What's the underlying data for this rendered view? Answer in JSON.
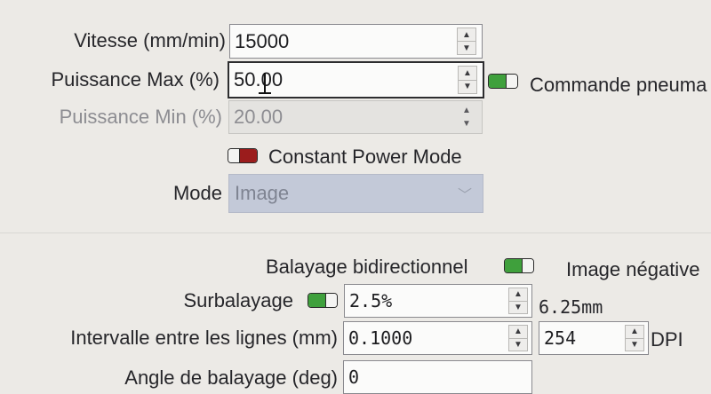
{
  "speed": {
    "label": "Vitesse (mm/min)",
    "value": "15000"
  },
  "power_max": {
    "label": "Puissance Max (%)",
    "value": "50.00"
  },
  "air_assist": {
    "label": "Commande pneuma"
  },
  "power_min": {
    "label": "Puissance Min (%)",
    "value": "20.00"
  },
  "constant_power": {
    "label": "Constant Power Mode"
  },
  "mode": {
    "label": "Mode",
    "value": "Image"
  },
  "bidirectional": {
    "label": "Balayage bidirectionnel"
  },
  "negative": {
    "label": "Image négative"
  },
  "overscan": {
    "label": "Surbalayage",
    "value": "2.5%",
    "computed": "6.25mm"
  },
  "line_interval": {
    "label": "Intervalle entre les lignes (mm)",
    "value": "0.1000",
    "dpi_value": "254",
    "dpi_unit": "DPI"
  },
  "scan_angle": {
    "label": "Angle de balayage (deg)",
    "value": "0"
  },
  "colors": {
    "toggle_on": "#3fa03c",
    "toggle_off": "#9b1c1c",
    "combo_disabled": "#c3c9d8"
  }
}
